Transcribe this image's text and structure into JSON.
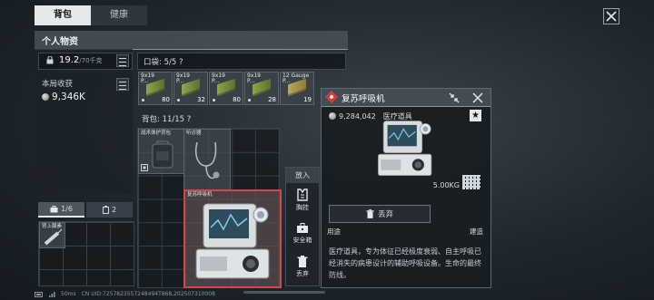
{
  "tabs": [
    {
      "label": "背包"
    },
    {
      "label": "健康"
    }
  ],
  "panel": {
    "title": "个人物资"
  },
  "weight": {
    "value": "19.2",
    "max": "/70千克"
  },
  "income": {
    "label": "本局收获",
    "value": "9,346K"
  },
  "left_tabs": [
    {
      "label": "1/6"
    },
    {
      "label": "2"
    }
  ],
  "left_item": {
    "name": "肾上腺素"
  },
  "pocket": {
    "label": "口袋: 5/5 ?"
  },
  "ammo": [
    {
      "caliber": "9x19",
      "sub": "P...",
      "count": "80"
    },
    {
      "caliber": "9x19",
      "sub": "P...",
      "count": "32"
    },
    {
      "caliber": "9x19",
      "sub": "P...",
      "count": "80"
    },
    {
      "caliber": "9x19",
      "sub": "P...",
      "count": "28"
    },
    {
      "caliber": "12 Gauge",
      "sub": "P...",
      "count": "19"
    }
  ],
  "backpack": {
    "label": "背包: 11/15 ?"
  },
  "bag_items": [
    {
      "name": "战术体护背包"
    },
    {
      "name": "听诊器"
    },
    {
      "name": "复苏呼吸机"
    }
  ],
  "actions": {
    "header": "放入",
    "items": [
      {
        "label": "胸挂"
      },
      {
        "label": "安全箱"
      },
      {
        "label": "丢弃"
      }
    ]
  },
  "detail": {
    "title": "复苏呼吸机",
    "price": "9,284,042",
    "category": "医疗道具",
    "weight": "5.00KG",
    "discard": "丢弃",
    "use_left": "用途",
    "use_right": "建造",
    "description": "医疗道具，专为体征已经极度衰弱、自主呼吸已经消失的病患设计的辅助呼吸设备。生命的最终防线。"
  },
  "status": {
    "ping": "50ms",
    "uid": "CN UID:7257823557248494T868,202507310008"
  },
  "colors": {
    "accent_red": "#d23c3c",
    "selected_border": "#d04848"
  }
}
